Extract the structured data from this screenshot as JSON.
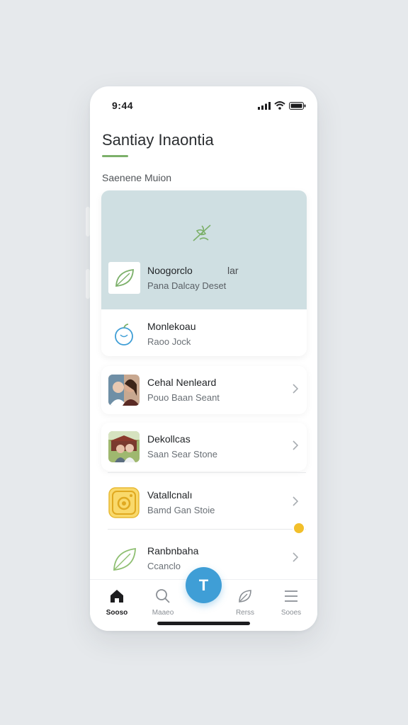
{
  "status_bar": {
    "time": "9:44"
  },
  "header": {
    "title": "Santiay Inaontia",
    "section_label": "Saenene Muion"
  },
  "featured": {
    "name": "Noogorclo",
    "tag": "lar",
    "subtitle": "Pana Dalcay Deset",
    "secondary": {
      "name": "Monlekoau",
      "subtitle": "Raoo Jock"
    }
  },
  "list": [
    {
      "name": "Cehal Nenleard",
      "subtitle": "Pouo Baan Seant"
    },
    {
      "name": "Dekollcas",
      "subtitle": "Saan Sear Stone"
    },
    {
      "name": "Vatallcnalı",
      "subtitle": "Bamd Gan Stoie"
    },
    {
      "name": "Ranbnbaha",
      "subtitle": "Ccanclo"
    }
  ],
  "fab": {
    "label": "T"
  },
  "tabbar": [
    {
      "label": "Sooso",
      "active": true
    },
    {
      "label": "Maaeo",
      "active": false
    },
    {
      "label": "Rerss",
      "active": false
    },
    {
      "label": "Sooes",
      "active": false
    }
  ],
  "colors": {
    "accent": "#3f9ed6",
    "underline": "#7cb06a",
    "badge": "#f2bf2a",
    "hero": "#cfdfe2"
  }
}
